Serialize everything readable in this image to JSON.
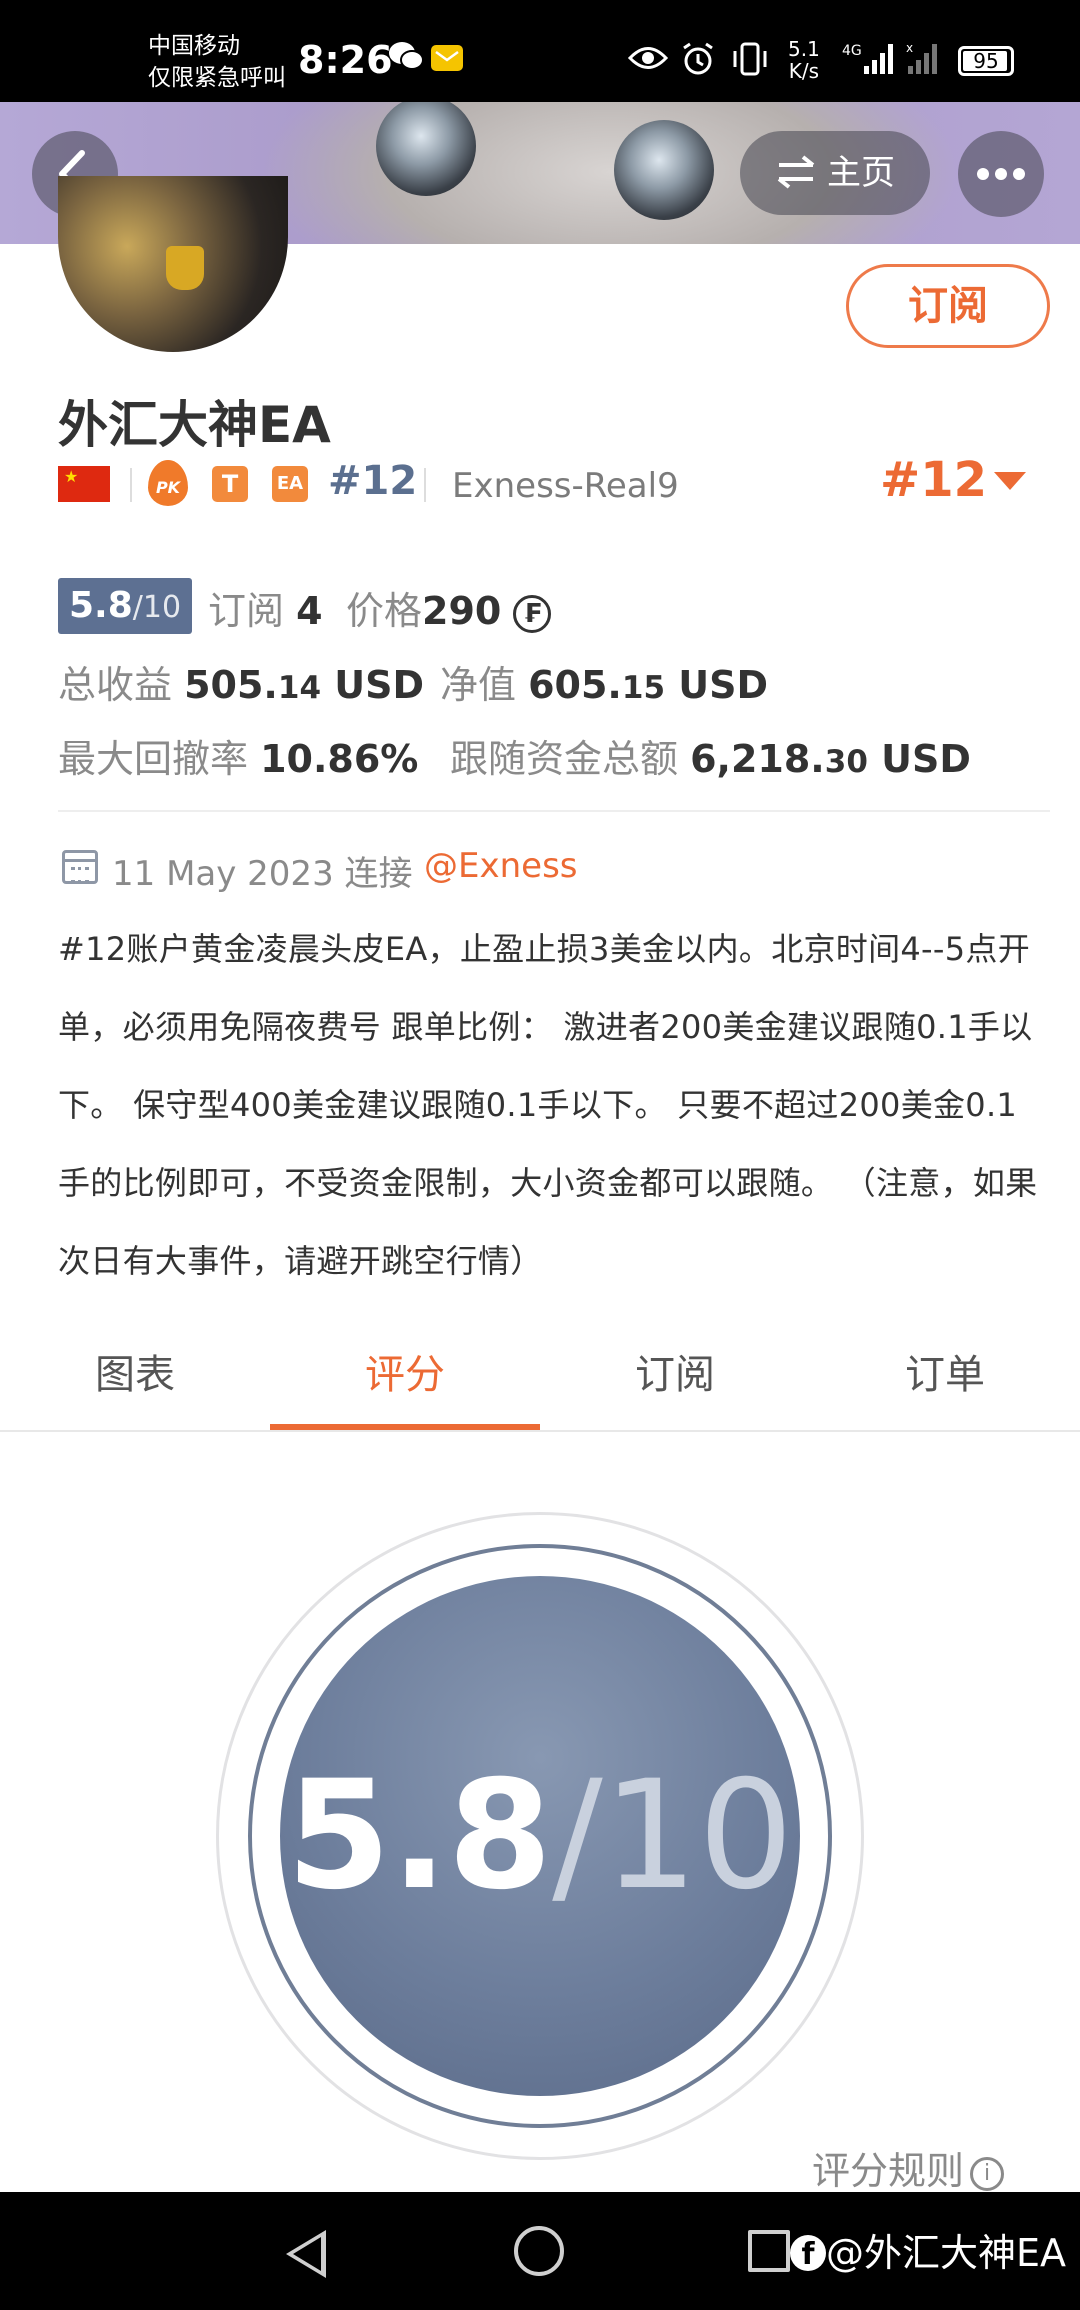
{
  "status_bar": {
    "carrier_line1": "中国移动",
    "carrier_line2": "仅限紧急呼叫",
    "time": "8:26",
    "net_speed_value": "5.1",
    "net_speed_unit": "K/s",
    "network": "4G",
    "battery": "95",
    "battery_level": 0.95
  },
  "header": {
    "home_label": "主页"
  },
  "profile": {
    "subscribe_label": "订阅",
    "name": "外汇大神EA",
    "pk_label": "PK",
    "t_label": "T",
    "ea_label": "EA",
    "rank_small": "#12",
    "server": "Exness-Real9",
    "rank_big": "#12"
  },
  "stats": {
    "score": "5.8",
    "score_den": "/10",
    "subscribe_label": "订阅",
    "subscribe_count": "4",
    "price_label": "价格",
    "price_value": "290",
    "total_profit_label": "总收益",
    "total_profit_int": "505.",
    "total_profit_dec": "14",
    "total_profit_unit": " USD",
    "equity_label": "净值",
    "equity_int": "605.",
    "equity_dec": "15",
    "equity_unit": " USD",
    "drawdown_label": "最大回撤率",
    "drawdown_value": "10.86%",
    "follow_funds_label": "跟随资金总额",
    "follow_funds_int": "6,218.",
    "follow_funds_dec": "30",
    "follow_funds_unit": " USD"
  },
  "info": {
    "date": "11 May 2023 连接",
    "broker": "@Exness",
    "description": "#12账户黄金凌晨头皮EA，止盈止损3美金以内。北京时间4--5点开单，必须用免隔夜费号 跟单比例： 激进者200美金建议跟随0.1手以下。 保守型400美金建议跟随0.1手以下。 只要不超过200美金0.1手的比例即可，不受资金限制，大小资金都可以跟随。 （注意，如果次日有大事件，请避开跳空行情）"
  },
  "tabs": [
    {
      "label": "图表",
      "active": false
    },
    {
      "label": "评分",
      "active": true
    },
    {
      "label": "订阅",
      "active": false
    },
    {
      "label": "订单",
      "active": false
    }
  ],
  "rating": {
    "score": "5.8",
    "den": "/10",
    "rules_label": "评分规则"
  },
  "watermark": "@外汇大神EA",
  "colors": {
    "accent": "#ec6a34",
    "score_blue": "#5d7092",
    "banner": "#b5a8d6"
  },
  "icons": [
    "back-icon",
    "switch-icon",
    "more-icon",
    "calendar-icon",
    "info-icon",
    "coin-icon",
    "dropdown-icon"
  ]
}
